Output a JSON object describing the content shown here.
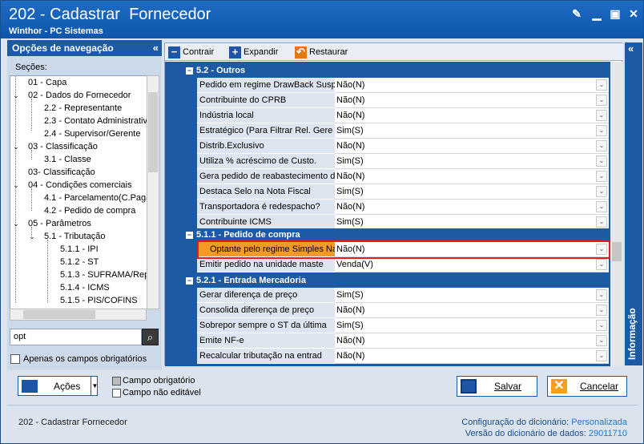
{
  "window": {
    "title": "202 - Cadastrar  Fornecedor",
    "subtitle": "Winthor - PC Sistemas"
  },
  "nav": {
    "header": "Opções de navegação",
    "collapse": "«",
    "sections_label": "Seções:",
    "tree": [
      {
        "label": "01 - Capa"
      },
      {
        "label": "02 - Dados do Fornecedor"
      },
      {
        "label": "2.2 - Representante"
      },
      {
        "label": "2.3 - Contato Administrativ"
      },
      {
        "label": "2.4 - Supervisor/Gerente"
      },
      {
        "label": "03 - Classificação"
      },
      {
        "label": "3.1 - Classe"
      },
      {
        "label": "03- Classificação"
      },
      {
        "label": "04 - Condições comerciais"
      },
      {
        "label": "4.1 - Parcelamento(C.Paga"
      },
      {
        "label": "4.2 - Pedido de compra"
      },
      {
        "label": "05 - Parâmetros"
      },
      {
        "label": "5.1 - Tributação"
      },
      {
        "label": "5.1.1 - IPI"
      },
      {
        "label": "5.1.2 - ST"
      },
      {
        "label": "5.1.3 - SUFRAMA/Rep"
      },
      {
        "label": "5.1.4 - ICMS"
      },
      {
        "label": "5.1.5 - PIS/COFINS"
      }
    ],
    "search_value": "opt",
    "only_required_label": "Apenas os campos obrigatórios"
  },
  "toolbar": {
    "contrair": "Contrair",
    "expandir": "Expandir",
    "restaurar": "Restaurar"
  },
  "grid": {
    "sections": [
      {
        "title": "5.2 - Outros",
        "rows": [
          {
            "prop": "Pedido em regime DrawBack Suspe",
            "value": "Não(N)"
          },
          {
            "prop": "Contribuinte do CPRB",
            "value": "Não(N)"
          },
          {
            "prop": "Indústria local",
            "value": "Não(N)"
          },
          {
            "prop": "Estratégico  (Para Filtrar Rel. Gere",
            "value": "Sim(S)"
          },
          {
            "prop": "Distrib.Exclusivo",
            "value": "Não(N)"
          },
          {
            "prop": "Utiliza % acréscimo de Custo.",
            "value": "Sim(S)"
          },
          {
            "prop": "Gera pedido de reabastecimento d",
            "value": "Não(N)"
          },
          {
            "prop": "Destaca Selo na Nota Fiscal",
            "value": "Sim(S)"
          },
          {
            "prop": "Transportadora é redespacho?",
            "value": "Não(N)"
          },
          {
            "prop": "Contribuinte ICMS",
            "value": "Sim(S)"
          }
        ]
      },
      {
        "title": "5.1.1 - Pedido de compra",
        "rows": [
          {
            "prop": "Optante pelo regime Simples Na",
            "value": "Não(N)"
          },
          {
            "prop": "Emitir pedido na unidade maste",
            "value": "Venda(V)"
          }
        ]
      },
      {
        "title": "5.2.1 - Entrada Mercadoria",
        "rows": [
          {
            "prop": "Gerar diferença de preço",
            "value": "Sim(S)"
          },
          {
            "prop": "Consolida diferença de preço",
            "value": "Não(N)"
          },
          {
            "prop": "Sobrepor sempre o ST da última",
            "value": "Sim(S)"
          },
          {
            "prop": "Emite NF-e",
            "value": "Não(N)"
          },
          {
            "prop": "Recalcular tributação na entrad",
            "value": "Não(N)"
          }
        ]
      }
    ]
  },
  "info_panel": {
    "label": "Informação",
    "collapse": "«"
  },
  "footer": {
    "acoes": "Ações",
    "legend_required": "Campo obrigatório",
    "legend_noneditable": "Campo não editável",
    "salvar": "Salvar",
    "cancelar": "Cancelar",
    "screen_name": "202 - Cadastrar  Fornecedor",
    "config_label": "Configuração do dicionário:",
    "config_value": "Personalizada",
    "version_label": "Versão do dicionário de dados:",
    "version_value": "29011710"
  },
  "colors": {
    "accent": "#1c5aa4",
    "selected_row": "#f59a24",
    "highlight_box": "#e31d1d"
  }
}
